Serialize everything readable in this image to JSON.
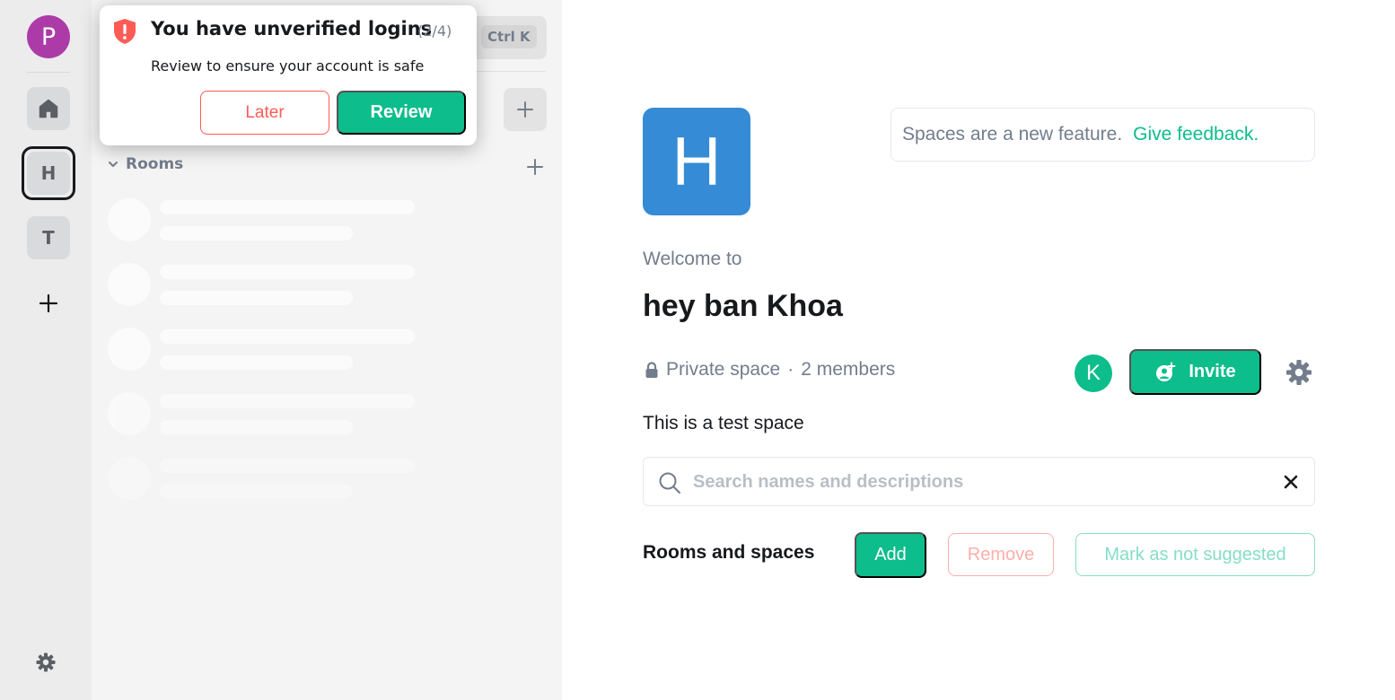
{
  "rail": {
    "user_initial": "P",
    "spaces": [
      {
        "icon": "home-icon"
      },
      {
        "initial": "H",
        "selected": true
      },
      {
        "initial": "T"
      }
    ],
    "add_icon": "plus-icon",
    "settings_icon": "gear-icon"
  },
  "room_list": {
    "shortcut": "Ctrl K",
    "section_label": "Rooms",
    "skeleton_rows": 5
  },
  "toast": {
    "title": "You have unverified logins",
    "count": "(2/4)",
    "description": "Review to ensure your account is safe",
    "later_label": "Later",
    "review_label": "Review"
  },
  "space": {
    "avatar_initial": "H",
    "feedback_text": "Spaces are a new feature.",
    "feedback_link": "Give feedback.",
    "welcome": "Welcome to",
    "name": "hey ban Khoa",
    "visibility": "Private space",
    "separator": "·",
    "members": "2 members",
    "member_initial": "K",
    "invite_label": "Invite",
    "topic": "This is a test space",
    "search_placeholder": "Search names and descriptions",
    "rooms_label": "Rooms and spaces",
    "add_label": "Add",
    "remove_label": "Remove",
    "mark_label": "Mark as not suggested"
  },
  "colors": {
    "accent": "#0dbd8b",
    "alert": "#ff5b55",
    "space_avatar": "#368bd6",
    "user_avatar": "#ac3ba8"
  }
}
